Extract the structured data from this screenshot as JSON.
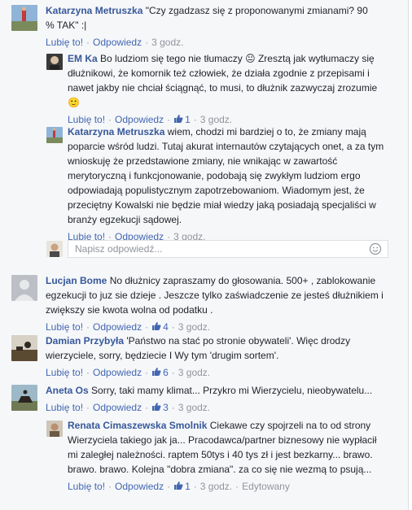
{
  "actions": {
    "like": "Lubię to!",
    "reply": "Odpowiedz",
    "edited": "Edytowany",
    "separator": "·"
  },
  "reply_input": {
    "placeholder": "Napisz odpowiedź..."
  },
  "comments": [
    {
      "author": "Katarzyna Metruszka",
      "text": "\"Czy zgadzasz się z proponowanymi zmianami? 90 % TAK\" :|",
      "time": "3 godz."
    },
    {
      "author": "EM Ka",
      "text": "Bo ludziom się tego nie tłumaczy 😐 Zresztą jak wytłumaczy się dłużnikowi, że komornik też człowiek, że działa zgodnie z przepisami i nawet jakby nie chciał ściągnąć, to musi, to dłużnik zazwyczaj zrozumie 🙂",
      "likes": "1",
      "time": "3 godz."
    },
    {
      "author": "Katarzyna Metruszka",
      "text": "wiem, chodzi mi bardziej o to, że zmiany mają poparcie wśród ludzi. Tutaj akurat internautów czytających onet, a za tym wnioskuję że przedstawione zmiany, nie wnikając w zawartość merytoryczną i funkcjonowanie, podobają się zwykłym ludziom ergo odpowiadają populistycznym zapotrzebowaniom. Wiadomym jest, że przeciętny Kowalski nie będzie miał wiedzy jaką posiadają specjaliści w branży egzekucji sądowej.",
      "time": "3 godz."
    },
    {
      "author": "Lucjan Bome",
      "text": "No dłużnicy zapraszamy do głosowania. 500+ , zablokowanie egzekucji to juz sie dzieje . Jeszcze tylko zaświadczenie ze jesteś dłużnikiem i zwiększy sie kwota wolna od podatku .",
      "likes": "4",
      "time": "3 godz."
    },
    {
      "author": "Damian Przybyła",
      "text": "'Państwo na stać po stronie obywateli'. Więc drodzy wierzyciele, sorry, będziecie I Wy tym 'drugim sortem'.",
      "likes": "6",
      "time": "3 godz."
    },
    {
      "author": "Aneta Os",
      "text": "Sorry, taki mamy klimat... Przykro mi Wierzycielu, nieobywatelu...",
      "likes": "3",
      "time": "3 godz."
    },
    {
      "author": "Renata Cimaszewska Smolnik",
      "text": "Ciekawe czy spojrzeli na to od strony Wierzyciela takiego jak ja... Pracodawca/partner biznesowy nie wypłacił mi zaległej należności. raptem 50tys i 40 tys zł i jest bezkarny... brawo. brawo. brawo. Kolejna \"dobra zmiana\". za co się nie wezmą to psują...",
      "likes": "1",
      "time": "3 godz."
    }
  ],
  "icons": {
    "like": "thumbs-up-icon",
    "emoji": "smiley-icon"
  },
  "colors": {
    "author_link": "#365899",
    "action_link": "#4267b2",
    "meta_gray": "#90949c",
    "background": "#f6f7f9"
  }
}
